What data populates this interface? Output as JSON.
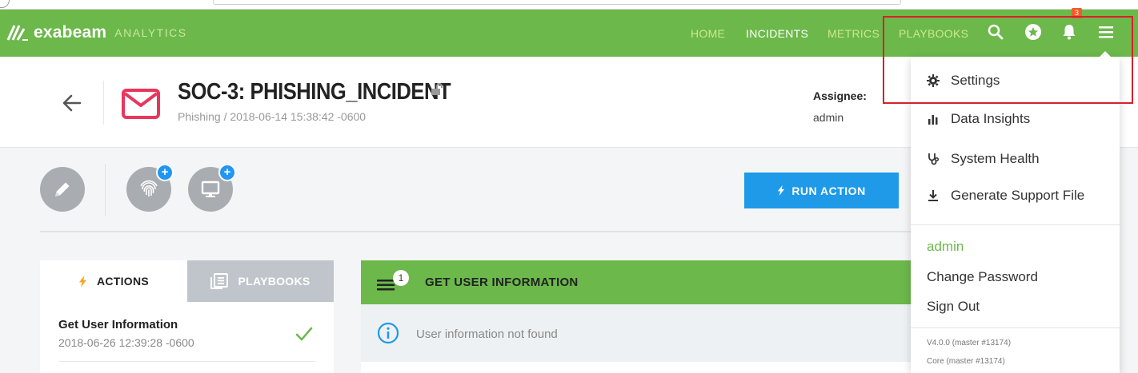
{
  "brand": {
    "name": "exabeam",
    "sub": "ANALYTICS"
  },
  "nav": {
    "items": [
      {
        "label": "HOME"
      },
      {
        "label": "INCIDENTS"
      },
      {
        "label": "METRICS"
      },
      {
        "label": "PLAYBOOKS"
      }
    ],
    "notification_count": "3",
    "colors": {
      "bar": "#6cb84b",
      "link": "#cfe88d",
      "active": "#ffffff",
      "badge": "#f25b2a"
    }
  },
  "incident": {
    "title": "SOC-3: PHISHING_INCIDENT",
    "subtitle": "Phishing / 2018-06-14 15:38:42 -0600",
    "assignee_label": "Assignee:",
    "assignee_value": "admin"
  },
  "actions_bar": {
    "run_action_label": "RUN ACTION",
    "plus_glyph": "+"
  },
  "left_panel": {
    "tabs": [
      {
        "label": "ACTIONS",
        "active": true
      },
      {
        "label": "PLAYBOOKS",
        "active": false
      }
    ],
    "items": [
      {
        "title": "Get User Information",
        "date": "2018-06-26 12:39:28 -0600",
        "status": "check-icon"
      }
    ]
  },
  "main_panel": {
    "count": "1",
    "title": "GET USER INFORMATION",
    "info_text": "User information not found"
  },
  "dropdown": {
    "items": [
      {
        "label": "Settings",
        "icon": "gear-icon"
      },
      {
        "label": "Data Insights",
        "icon": "bar-chart-icon"
      },
      {
        "label": "System Health",
        "icon": "stethoscope-icon"
      },
      {
        "label": "Generate Support File",
        "icon": "download-icon"
      }
    ],
    "user": "admin",
    "change_password": "Change Password",
    "sign_out": "Sign Out",
    "version": "V4.0.0 (master #13174)",
    "core": "Core (master #13174)"
  },
  "accent_colors": {
    "green": "#6cb84b",
    "blue": "#1e9ae8",
    "mail": "#e8365d",
    "highlight": "#d7212b"
  }
}
